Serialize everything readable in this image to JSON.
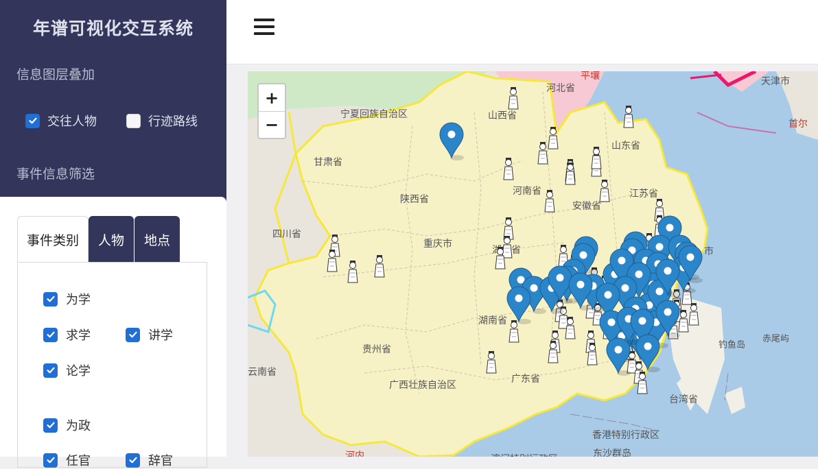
{
  "app": {
    "title": "年谱可视化交互系统"
  },
  "sidebar": {
    "layers_title": "信息图层叠加",
    "layers": [
      {
        "label": "交往人物",
        "checked": true
      },
      {
        "label": "行迹路线",
        "checked": false
      }
    ],
    "filter_title": "事件信息筛选",
    "tabs": [
      {
        "label": "事件类别",
        "active": true
      },
      {
        "label": "人物",
        "active": false
      },
      {
        "label": "地点",
        "active": false
      }
    ],
    "categories": [
      {
        "label": "为学",
        "checked": true
      },
      {
        "label": "求学",
        "checked": true
      },
      {
        "label": "讲学",
        "checked": true
      },
      {
        "label": "论学",
        "checked": true
      },
      {
        "label": "为政",
        "checked": true
      },
      {
        "label": "任官",
        "checked": true
      },
      {
        "label": "辞官",
        "checked": true
      }
    ]
  },
  "header": {
    "menu_icon": "hamburger-menu-icon"
  },
  "map": {
    "zoom_in": "+",
    "zoom_out": "−",
    "colors": {
      "water": "#a9cbe8",
      "land": "#f7f1c6",
      "border": "#f5e83b",
      "other_land": "#e9e5dc",
      "hebei": "#f6c9d4",
      "ningxia": "#cfe9c6"
    },
    "labels": [
      {
        "text": "河北省",
        "cls": ""
      },
      {
        "text": "宁夏回族自治区",
        "cls": ""
      },
      {
        "text": "山西省",
        "cls": ""
      },
      {
        "text": "山东省",
        "cls": ""
      },
      {
        "text": "甘肃省",
        "cls": ""
      },
      {
        "text": "河南省",
        "cls": ""
      },
      {
        "text": "江苏省",
        "cls": ""
      },
      {
        "text": "陕西省",
        "cls": ""
      },
      {
        "text": "安徽省",
        "cls": ""
      },
      {
        "text": "四川省",
        "cls": ""
      },
      {
        "text": "重庆市",
        "cls": ""
      },
      {
        "text": "湖北省",
        "cls": ""
      },
      {
        "text": "湖南省",
        "cls": ""
      },
      {
        "text": "贵州省",
        "cls": ""
      },
      {
        "text": "云南省",
        "cls": ""
      },
      {
        "text": "广西壮族自治区",
        "cls": ""
      },
      {
        "text": "广东省",
        "cls": ""
      },
      {
        "text": "钓鱼岛",
        "cls": "sm"
      },
      {
        "text": "赤尾屿",
        "cls": "sm"
      },
      {
        "text": "台湾省",
        "cls": ""
      },
      {
        "text": "香港特别行政区",
        "cls": ""
      },
      {
        "text": "东沙群岛",
        "cls": ""
      },
      {
        "text": "平壤",
        "cls": "red"
      },
      {
        "text": "首尔",
        "cls": "red"
      },
      {
        "text": "河内",
        "cls": "red"
      },
      {
        "text": "澳门特别行政区",
        "cls": ""
      },
      {
        "text": "天津市",
        "cls": ""
      },
      {
        "text": "市",
        "cls": ""
      }
    ]
  }
}
